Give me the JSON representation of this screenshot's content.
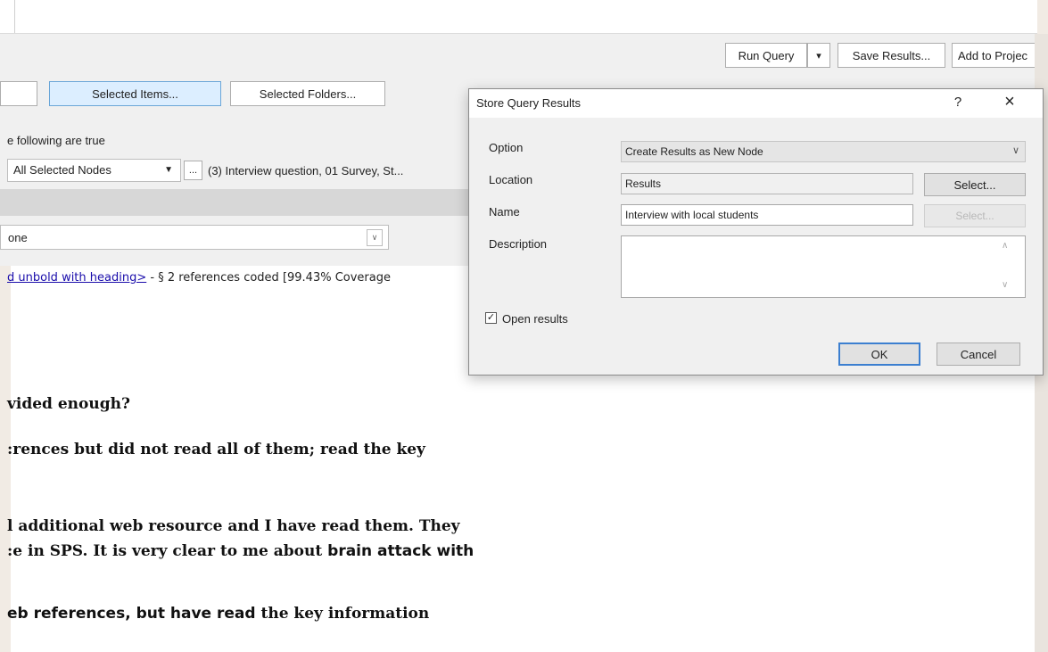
{
  "toolbar": {
    "run_query": "Run Query",
    "dropdown_arrow": "▾",
    "save_results": "Save Results...",
    "add_to_project": "Add to Projec"
  },
  "scope": {
    "selected_items": "Selected Items...",
    "selected_folders": "Selected Folders..."
  },
  "criteria": {
    "following_true": "e following are true",
    "nodes_combo": "All Selected Nodes",
    "ellipsis_button": "...",
    "nodes_list": "(3) Interview question, 01 Survey, St...",
    "none_combo": "one"
  },
  "results_line": {
    "link": "d unbold with heading>",
    "rest": " - § 2 references coded  [99.43% Coverage"
  },
  "document": {
    "line1": "vided enough?",
    "line2": ":rences but did not read all of them; read the key",
    "line3": "l additional web resource and I have read them. They",
    "line4a": ":e in SPS. It is very clear to me about ",
    "line4b": "brain attack with",
    "line5a": "eb references, but have read",
    "line5b": " the key information"
  },
  "dialog": {
    "title": "Store Query Results",
    "help": "?",
    "close": "×",
    "option_label": "Option",
    "option_value": "Create Results as New Node",
    "location_label": "Location",
    "location_value": "Results",
    "select_button": "Select...",
    "name_label": "Name",
    "name_value": "Interview with local students",
    "select_disabled": "Select...",
    "description_label": "Description",
    "description_value": "",
    "open_results_label": "Open results",
    "open_results_checked": true,
    "ok": "OK",
    "cancel": "Cancel"
  }
}
